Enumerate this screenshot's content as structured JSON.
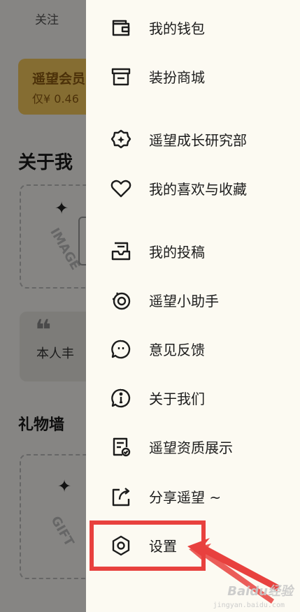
{
  "background": {
    "follow_label": "关注",
    "vip_title": "遥望会员",
    "vip_price": "仅¥ 0.46",
    "about_title": "关于我",
    "card_image_word": "IMAGE",
    "quote_mark": "❝",
    "intro_text": "本人丰",
    "gift_title": "礼物墙",
    "card_gift_word": "GIFT"
  },
  "drawer": {
    "items": [
      {
        "label": "我的钱包",
        "icon": "wallet-icon"
      },
      {
        "label": "装扮商城",
        "icon": "store-icon"
      },
      {
        "label": "遥望成长研究部",
        "icon": "gear-sparkle-icon"
      },
      {
        "label": "我的喜欢与收藏",
        "icon": "heart-icon"
      },
      {
        "label": "我的投稿",
        "icon": "submission-icon"
      },
      {
        "label": "遥望小助手",
        "icon": "assistant-icon"
      },
      {
        "label": "意见反馈",
        "icon": "feedback-icon"
      },
      {
        "label": "关于我们",
        "icon": "info-icon"
      },
      {
        "label": "遥望资质展示",
        "icon": "certificate-icon"
      },
      {
        "label": "分享遥望 ~",
        "icon": "share-icon"
      },
      {
        "label": "设置",
        "icon": "settings-icon"
      }
    ]
  },
  "annotation": {
    "color": "#e8413e",
    "watermark": "Baidu经验",
    "watermark_sub": "jingyan.baidu.com"
  }
}
